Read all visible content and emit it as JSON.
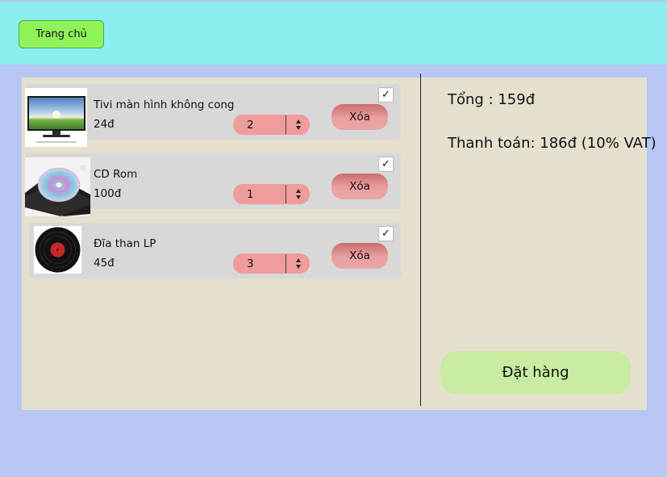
{
  "header": {
    "home_label": "Trang chủ"
  },
  "cart": {
    "items": [
      {
        "name": "Tivi màn hình không cong",
        "price": "24đ",
        "quantity": "2",
        "delete_label": "Xóa",
        "checked": true,
        "image": "tv-image"
      },
      {
        "name": "CD Rom",
        "price": "100đ",
        "quantity": "1",
        "delete_label": "Xóa",
        "checked": true,
        "image": "cd-rom-image"
      },
      {
        "name": "Đĩa than LP",
        "price": "45đ",
        "quantity": "3",
        "delete_label": "Xóa",
        "checked": true,
        "image": "vinyl-record-image"
      }
    ],
    "check_glyph": "✓"
  },
  "summary": {
    "total": "Tổng : 159đ",
    "payment": "Thanh toán: 186đ (10% VAT)",
    "order_label": "Đặt hàng"
  },
  "colors": {
    "header_bg": "#8befef",
    "home_button": "#8ff45a",
    "panel_bg": "#e6e0cf",
    "page_bg": "#b7c6f3",
    "quantity_bg": "#f09c9c",
    "delete_button": "#e9a5a5",
    "order_button": "#c8eca2"
  }
}
